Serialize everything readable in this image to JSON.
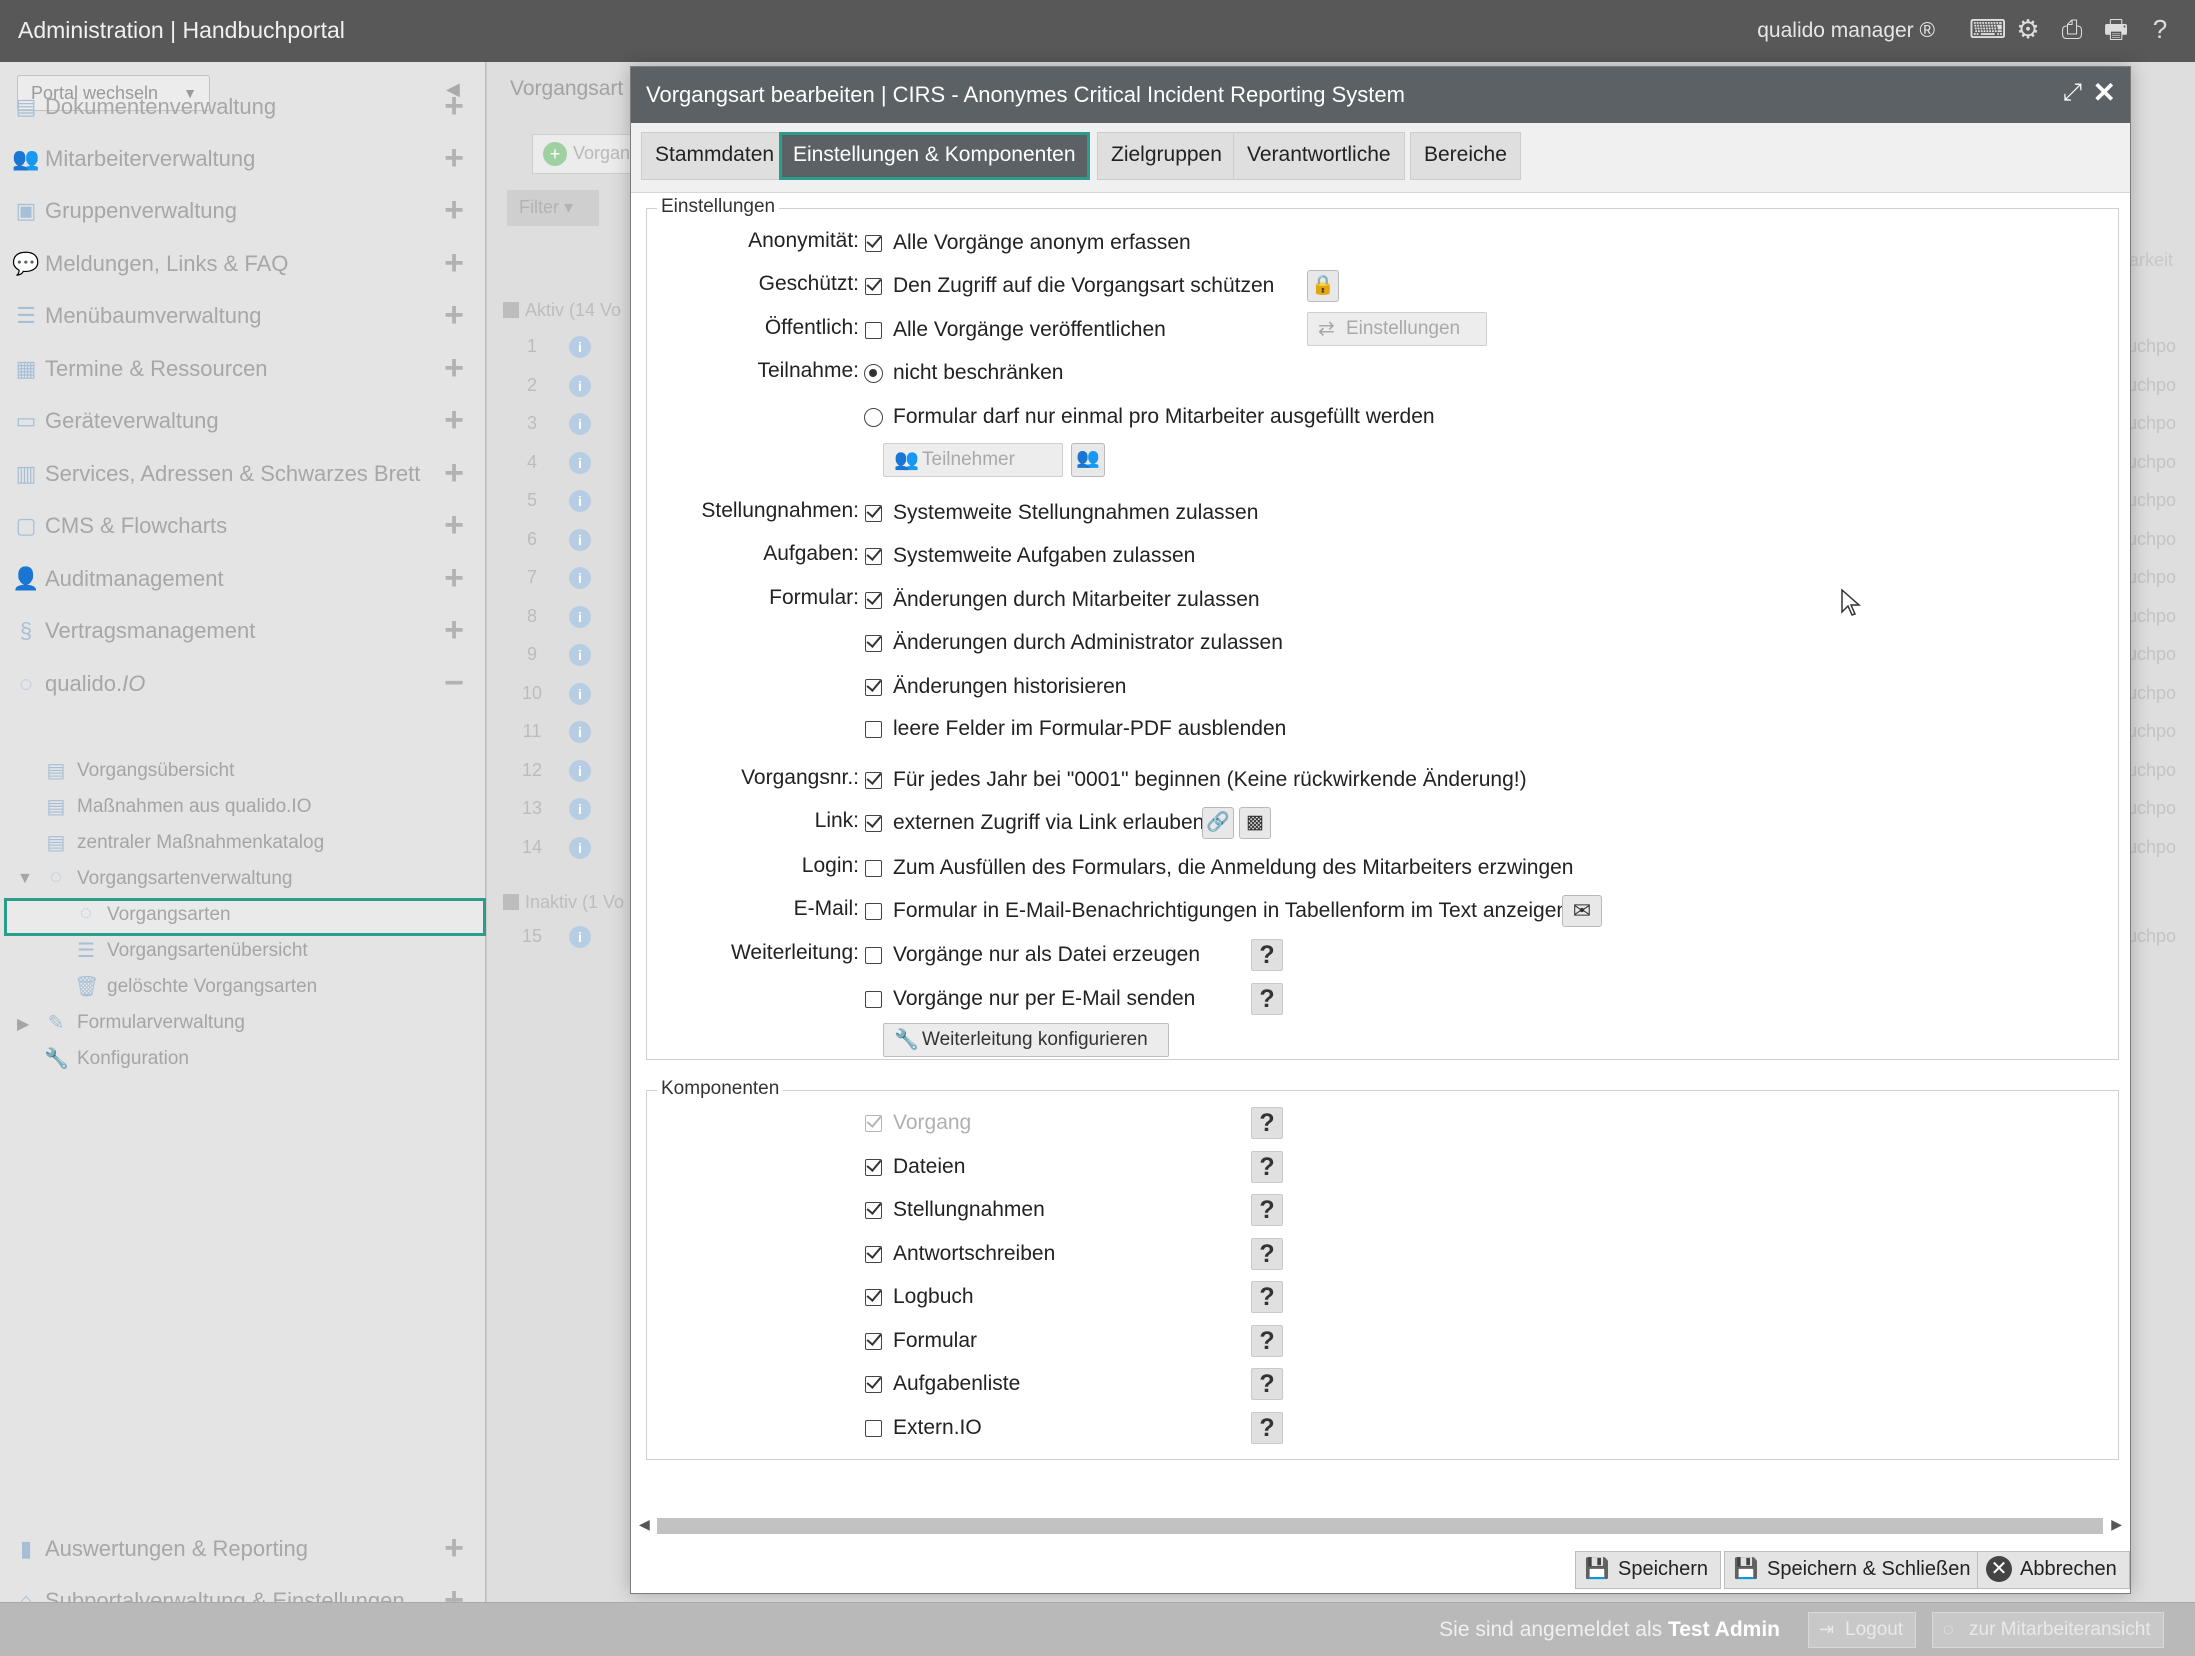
{
  "topbar": {
    "title": "Administration | Handbuchportal",
    "brand": "qualido manager ®",
    "icons": [
      "keyboard-icon",
      "cogs-icon",
      "print-preview-icon",
      "printer-icon",
      "help-icon"
    ]
  },
  "sidebar": {
    "portal_select": "Portal wechseln",
    "items": [
      {
        "label": "Dokumentenverwaltung",
        "icon": "document-icon"
      },
      {
        "label": "Mitarbeiterverwaltung",
        "icon": "users-icon"
      },
      {
        "label": "Gruppenverwaltung",
        "icon": "group-icon"
      },
      {
        "label": "Meldungen, Links & FAQ",
        "icon": "chat-icon"
      },
      {
        "label": "Menübaumverwaltung",
        "icon": "list-icon"
      },
      {
        "label": "Termine & Ressourcen",
        "icon": "calendar-icon"
      },
      {
        "label": "Geräteverwaltung",
        "icon": "device-icon"
      },
      {
        "label": "Services, Adressen & Schwarzes Brett",
        "icon": "board-icon"
      },
      {
        "label": "CMS & Flowcharts",
        "icon": "cms-icon"
      },
      {
        "label": "Auditmanagement",
        "icon": "audit-icon"
      },
      {
        "label": "Vertragsmanagement",
        "icon": "paragraph-icon"
      }
    ],
    "qualido": {
      "label": "qualido.",
      "label_io": "IO"
    },
    "sub_items": [
      {
        "label": "Vorgangsübersicht"
      },
      {
        "label": "Maßnahmen aus qualido.IO"
      },
      {
        "label": "zentraler Maßnahmenkatalog"
      },
      {
        "label": "Vorgangsartenverwaltung"
      },
      {
        "label": "Vorgangsarten"
      },
      {
        "label": "Vorgangsartenübersicht"
      },
      {
        "label": "gelöschte Vorgangsarten"
      },
      {
        "label": "Formularverwaltung"
      },
      {
        "label": "Konfiguration"
      }
    ],
    "bottom_items": [
      {
        "label": "Auswertungen & Reporting"
      },
      {
        "label": "Subportalverwaltung & Einstellungen"
      }
    ]
  },
  "midpane": {
    "title": "Vorgangsart",
    "add_button": "Vorgan",
    "filter": "Filter",
    "group_active": "Aktiv (14 Vo",
    "group_inactive": "Inaktiv (1 Vo",
    "col_right": "arkeit",
    "row_tail": "uchpo",
    "rows_active": [
      "1",
      "2",
      "3",
      "4",
      "5",
      "6",
      "7",
      "8",
      "9",
      "10",
      "11",
      "12",
      "13",
      "14"
    ],
    "rows_inactive": [
      "15"
    ]
  },
  "bottombar": {
    "logged_in_prefix": "Sie sind angemeldet als",
    "user": "Test Admin",
    "logout": "Logout",
    "employee_view": "zur Mitarbeiteransicht"
  },
  "modal": {
    "title": "Vorgangsart bearbeiten | CIRS - Anonymes Critical Incident Reporting System",
    "tabs": [
      "Stammdaten",
      "Einstellungen & Komponenten",
      "Zielgruppen",
      "Verantwortliche",
      "Bereiche"
    ],
    "active_tab": "Einstellungen & Komponenten",
    "settings_legend": "Einstellungen",
    "settings": {
      "anonymitaet_label": "Anonymität:",
      "anonymitaet_opt": "Alle Vorgänge anonym erfassen",
      "geschuetzt_label": "Geschützt:",
      "geschuetzt_opt": "Den Zugriff auf die Vorgangsart schützen",
      "oeffentlich_label": "Öffentlich:",
      "oeffentlich_opt": "Alle Vorgänge veröffentlichen",
      "einstellungen_btn": "Einstellungen",
      "teilnahme_label": "Teilnahme:",
      "teilnahme_opt1": "nicht beschränken",
      "teilnahme_opt2": "Formular darf nur einmal pro Mitarbeiter ausgefüllt werden",
      "teilnehmer_btn": "Teilnehmer",
      "stellungnahmen_label": "Stellungnahmen:",
      "stellungnahmen_opt": "Systemweite Stellungnahmen zulassen",
      "aufgaben_label": "Aufgaben:",
      "aufgaben_opt": "Systemweite Aufgaben zulassen",
      "formular_label": "Formular:",
      "formular_opt1": "Änderungen durch Mitarbeiter zulassen",
      "formular_opt2": "Änderungen durch Administrator zulassen",
      "formular_opt3": "Änderungen historisieren",
      "formular_opt4": "leere Felder im Formular-PDF ausblenden",
      "vorgangsnr_label": "Vorgangsnr.:",
      "vorgangsnr_opt": "Für jedes Jahr bei \"0001\" beginnen (Keine rückwirkende Änderung!)",
      "link_label": "Link:",
      "link_opt": "externen Zugriff via Link erlauben",
      "login_label": "Login:",
      "login_opt": "Zum Ausfüllen des Formulars, die Anmeldung des Mitarbeiters erzwingen",
      "email_label": "E-Mail:",
      "email_opt": "Formular in E-Mail-Benachrichtigungen in Tabellenform im Text anzeigen",
      "weiterleitung_label": "Weiterleitung:",
      "weiterleitung_opt1": "Vorgänge nur als Datei erzeugen",
      "weiterleitung_opt2": "Vorgänge nur per E-Mail senden",
      "weiterleitung_btn": "Weiterleitung konfigurieren"
    },
    "components_legend": "Komponenten",
    "components": [
      {
        "label": "Vorgang",
        "checked": true,
        "disabled": true
      },
      {
        "label": "Dateien",
        "checked": true,
        "disabled": false
      },
      {
        "label": "Stellungnahmen",
        "checked": true,
        "disabled": false
      },
      {
        "label": "Antwortschreiben",
        "checked": true,
        "disabled": false
      },
      {
        "label": "Logbuch",
        "checked": true,
        "disabled": false
      },
      {
        "label": "Formular",
        "checked": true,
        "disabled": false
      },
      {
        "label": "Aufgabenliste",
        "checked": true,
        "disabled": false
      },
      {
        "label": "Extern.IO",
        "checked": false,
        "disabled": false
      }
    ],
    "help_mark": "?",
    "footer": {
      "save": "Speichern",
      "save_close": "Speichern & Schließen",
      "cancel": "Abbrechen"
    }
  },
  "colors": {
    "accent": "#2a9e8a",
    "header": "#5c6166",
    "topbar": "#585858"
  }
}
